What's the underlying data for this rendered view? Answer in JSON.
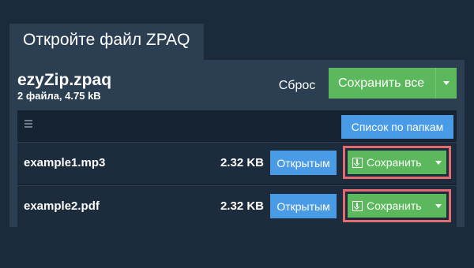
{
  "tab": {
    "title": "Откройте файл ZPAQ"
  },
  "archive": {
    "name": "ezyZip.zpaq",
    "meta": "2 файла, 4.75 kB"
  },
  "actions": {
    "reset_label": "Сброс",
    "save_all_label": "Сохранить все"
  },
  "list": {
    "folder_view_label": "Список по папкам",
    "rows": [
      {
        "name": "example1.mp3",
        "size": "2.32 KB",
        "open_label": "Открытым",
        "save_label": "Сохранить"
      },
      {
        "name": "example2.pdf",
        "size": "2.32 KB",
        "open_label": "Открытым",
        "save_label": "Сохранить"
      }
    ]
  },
  "icons": {
    "menu": "hamburger-icon",
    "download": "download-icon",
    "caret": "chevron-down-icon"
  },
  "colors": {
    "background": "#1c2b3b",
    "panel": "#2b3e52",
    "list": "#152332",
    "green": "#5cb85c",
    "blue": "#4a9be6",
    "highlight": "#e36a6e"
  }
}
